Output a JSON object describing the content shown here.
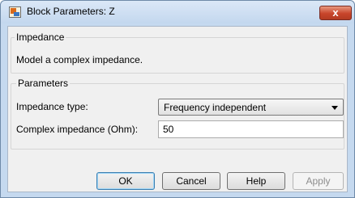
{
  "window": {
    "title": "Block Parameters: Z",
    "close_label": "x"
  },
  "description": {
    "group_title": "Impedance",
    "text": "Model a complex impedance."
  },
  "parameters": {
    "group_title": "Parameters",
    "impedance_type_label": "Impedance type:",
    "impedance_type_value": "Frequency independent",
    "complex_impedance_label": "Complex impedance (Ohm):",
    "complex_impedance_value": "50"
  },
  "buttons": {
    "ok": "OK",
    "cancel": "Cancel",
    "help": "Help",
    "apply": "Apply"
  }
}
